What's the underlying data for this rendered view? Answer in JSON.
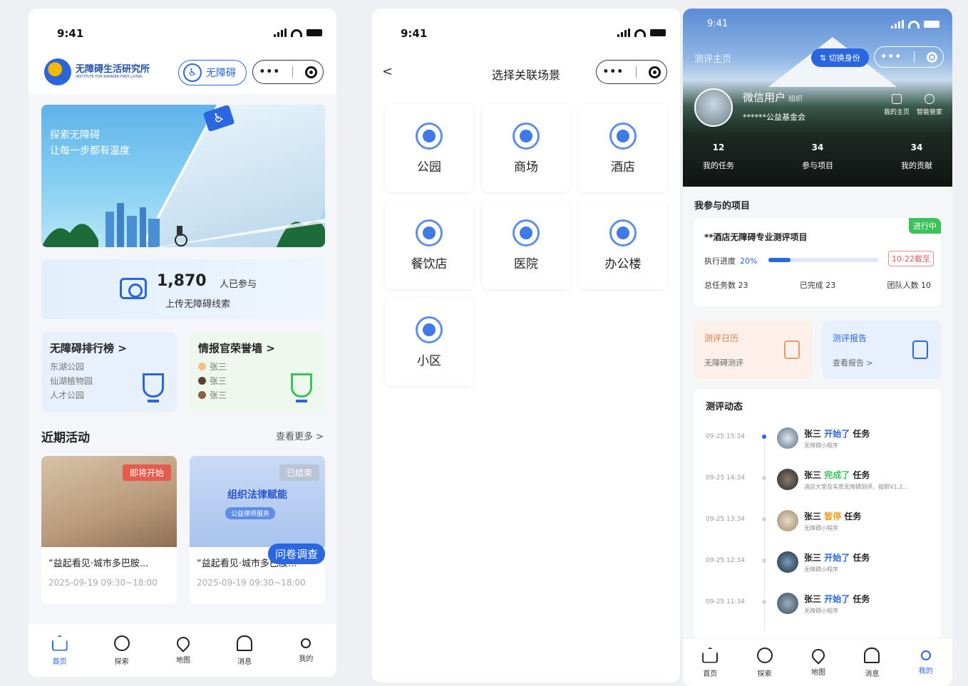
{
  "status_time": "9:41",
  "home": {
    "logo": {
      "name": "无障碍生活研究所",
      "sub": "INSTITUTE FOR BARRIER-FREE LIVING"
    },
    "access_button": "无障碍",
    "banner": {
      "line1": "探索无障碍",
      "line2": "让每一步都有温度"
    },
    "upload": {
      "count": "1,870",
      "unit": "人已参与",
      "label": "上传无障碍线索"
    },
    "ranking": {
      "title": "无障碍排行榜 >",
      "items": [
        "东湖公园",
        "仙湖植物园",
        "人才公园"
      ]
    },
    "honor": {
      "title": "情报官荣誉墙 >",
      "items": [
        "张三",
        "张三",
        "张三"
      ]
    },
    "recent_title": "近期活动",
    "more": "查看更多 >",
    "activities": [
      {
        "badge": "即将开始",
        "title": "“益起看见·城市多巴胺...",
        "time": "2025-09-19 09:30~18:00"
      },
      {
        "badge": "已结束",
        "overlay": "组织法律赋能",
        "overlay_sub": "公益律师服务",
        "survey": "问卷调查",
        "title": "“益起看见·城市多巴胺...",
        "time": "2025-09-19 09:30~18:00"
      }
    ]
  },
  "tabs": [
    "首页",
    "探索",
    "地图",
    "消息",
    "我的"
  ],
  "scenes": {
    "title": "选择关联场景",
    "back": "<",
    "items": [
      "公园",
      "商场",
      "酒店",
      "餐饮店",
      "医院",
      "办公楼",
      "小区"
    ]
  },
  "profile": {
    "page_title": "测评主页",
    "switch": "切换身份",
    "user": "微信用户",
    "user_tag": "组织",
    "org": "******公益基金会",
    "quick": [
      "我的主页",
      "智能管家"
    ],
    "stats": [
      {
        "value": "12",
        "label": "我的任务"
      },
      {
        "value": "34",
        "label": "参与项目"
      },
      {
        "value": "34",
        "label": "我的贡献"
      }
    ],
    "projects_title": "我参与的项目",
    "project": {
      "badge": "进行中",
      "title": "**酒店无障碍专业测评项目",
      "progress_label": "执行进度",
      "progress": "20%",
      "progress_value": 0.2,
      "deadline": "10-22截至",
      "total": "总任务数  23",
      "done": "已完成  23",
      "team": "团队人数  10"
    },
    "calendar": {
      "title": "测评日历",
      "sub": "无障碍测评"
    },
    "report": {
      "title": "测评报告",
      "sub": "查看报告 >"
    },
    "feed_title": "测评动态",
    "feed": [
      {
        "time": "09-25 15:34",
        "name": "张三",
        "action": "开始了",
        "type": "blue",
        "suffix": "任务",
        "sub": "无障碍小程序"
      },
      {
        "time": "09-25 14:34",
        "name": "张三",
        "action": "完成了",
        "type": "green",
        "suffix": "任务",
        "sub": "酒店大堂及车库无障碍测评，按照V1.2..."
      },
      {
        "time": "09-25 13:34",
        "name": "张三",
        "action": "暂停",
        "type": "orange",
        "suffix": "任务",
        "sub": "无障碍小程序"
      },
      {
        "time": "09-25 12:34",
        "name": "张三",
        "action": "开始了",
        "type": "blue",
        "suffix": "任务",
        "sub": "无障碍小程序"
      },
      {
        "time": "09-25 11:34",
        "name": "张三",
        "action": "开始了",
        "type": "blue",
        "suffix": "任务",
        "sub": "无障碍小程序"
      }
    ]
  },
  "colors": {
    "accent": "#2a66e0",
    "success": "#3cc25b",
    "warning": "#f0a020"
  }
}
